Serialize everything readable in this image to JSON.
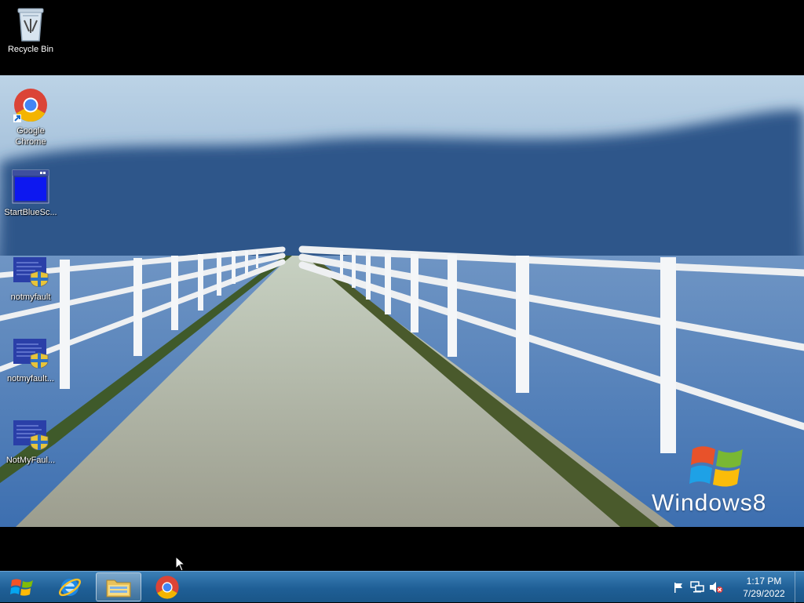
{
  "desktop": {
    "icons": [
      {
        "label": "Recycle Bin",
        "icon": "recycle-bin-icon"
      },
      {
        "label": "Google Chrome",
        "icon": "chrome-icon"
      },
      {
        "label": "StartBlueSc...",
        "icon": "bluescreen-app-icon"
      },
      {
        "label": "notmyfault",
        "icon": "notmyfault-icon"
      },
      {
        "label": "notmyfault...",
        "icon": "notmyfault-icon"
      },
      {
        "label": "NotMyFaul...",
        "icon": "notmyfault-icon"
      }
    ],
    "wallpaper_brand": "Windows8"
  },
  "taskbar": {
    "pinned": [
      {
        "name": "Internet Explorer",
        "icon": "ie-icon"
      },
      {
        "name": "File Explorer",
        "icon": "file-explorer-icon",
        "active": true
      },
      {
        "name": "Google Chrome",
        "icon": "chrome-icon"
      }
    ],
    "tray_icons": [
      "action-center-flag-icon",
      "network-icon",
      "volume-muted-icon"
    ],
    "clock": {
      "time": "1:17 PM",
      "date": "7/29/2022"
    }
  },
  "colors": {
    "taskbar": "#1f5f96",
    "accent": "#3b7fb6"
  }
}
